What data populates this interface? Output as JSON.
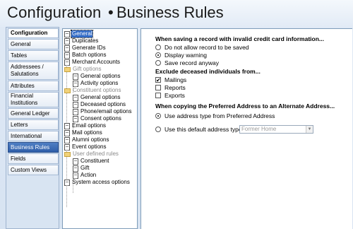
{
  "header": {
    "title": "Configuration",
    "separator": "•",
    "subtitle": "Business Rules"
  },
  "nav": [
    {
      "label": "Configuration"
    },
    {
      "label": "General"
    },
    {
      "label": "Tables"
    },
    {
      "label": "Addressees / Salutations"
    },
    {
      "label": "Attributes"
    },
    {
      "label": "Financial Institutions"
    },
    {
      "label": "General Ledger"
    },
    {
      "label": "Letters"
    },
    {
      "label": "International"
    },
    {
      "label": "Business Rules"
    },
    {
      "label": "Fields"
    },
    {
      "label": "Custom Views"
    }
  ],
  "tree": [
    {
      "label": "General",
      "type": "doc",
      "level": 0,
      "selected": true
    },
    {
      "label": "Duplicates",
      "type": "doc",
      "level": 0
    },
    {
      "label": "Generate IDs",
      "type": "doc",
      "level": 0
    },
    {
      "label": "Batch options",
      "type": "doc",
      "level": 0
    },
    {
      "label": "Merchant Accounts",
      "type": "doc",
      "level": 0
    },
    {
      "label": "Gift options",
      "type": "folder",
      "level": 0,
      "disabled": true
    },
    {
      "label": "General options",
      "type": "doc",
      "level": 1
    },
    {
      "label": "Activity options",
      "type": "doc",
      "level": 1
    },
    {
      "label": "Constituent options",
      "type": "folder",
      "level": 0,
      "disabled": true
    },
    {
      "label": "General options",
      "type": "doc",
      "level": 1
    },
    {
      "label": "Deceased options",
      "type": "doc",
      "level": 1
    },
    {
      "label": "Phone/email options",
      "type": "doc",
      "level": 1
    },
    {
      "label": "Consent options",
      "type": "doc",
      "level": 1
    },
    {
      "label": "Email options",
      "type": "doc",
      "level": 0
    },
    {
      "label": "Mail options",
      "type": "doc",
      "level": 0
    },
    {
      "label": "Alumni options",
      "type": "doc",
      "level": 0
    },
    {
      "label": "Event options",
      "type": "doc",
      "level": 0
    },
    {
      "label": "User defined rules",
      "type": "folder",
      "level": 0,
      "disabled": true
    },
    {
      "label": "Constituent",
      "type": "doc",
      "level": 1
    },
    {
      "label": "Gift",
      "type": "doc",
      "level": 1
    },
    {
      "label": "Action",
      "type": "doc",
      "level": 1
    },
    {
      "label": "System access options",
      "type": "doc",
      "level": 0
    }
  ],
  "panel": {
    "section1_title": "When saving a record with invalid credit card information...",
    "section1_options": [
      {
        "label": "Do not allow record to be saved",
        "checked": false
      },
      {
        "label": "Display warning",
        "checked": true
      },
      {
        "label": "Save record anyway",
        "checked": false
      }
    ],
    "section2_title": "Exclude deceased individuals from...",
    "section2_options": [
      {
        "label": "Mailings",
        "checked": true
      },
      {
        "label": "Reports",
        "checked": false
      },
      {
        "label": "Exports",
        "checked": false
      }
    ],
    "section3_title": "When copying the Preferred Address to an Alternate Address...",
    "section3_options": [
      {
        "label": "Use address type from Preferred Address",
        "checked": true
      },
      {
        "label": "Use this default address type:",
        "checked": false
      }
    ],
    "address_type_value": "Former Home",
    "check_mark": "✔",
    "dropdown_arrow": "▼"
  }
}
